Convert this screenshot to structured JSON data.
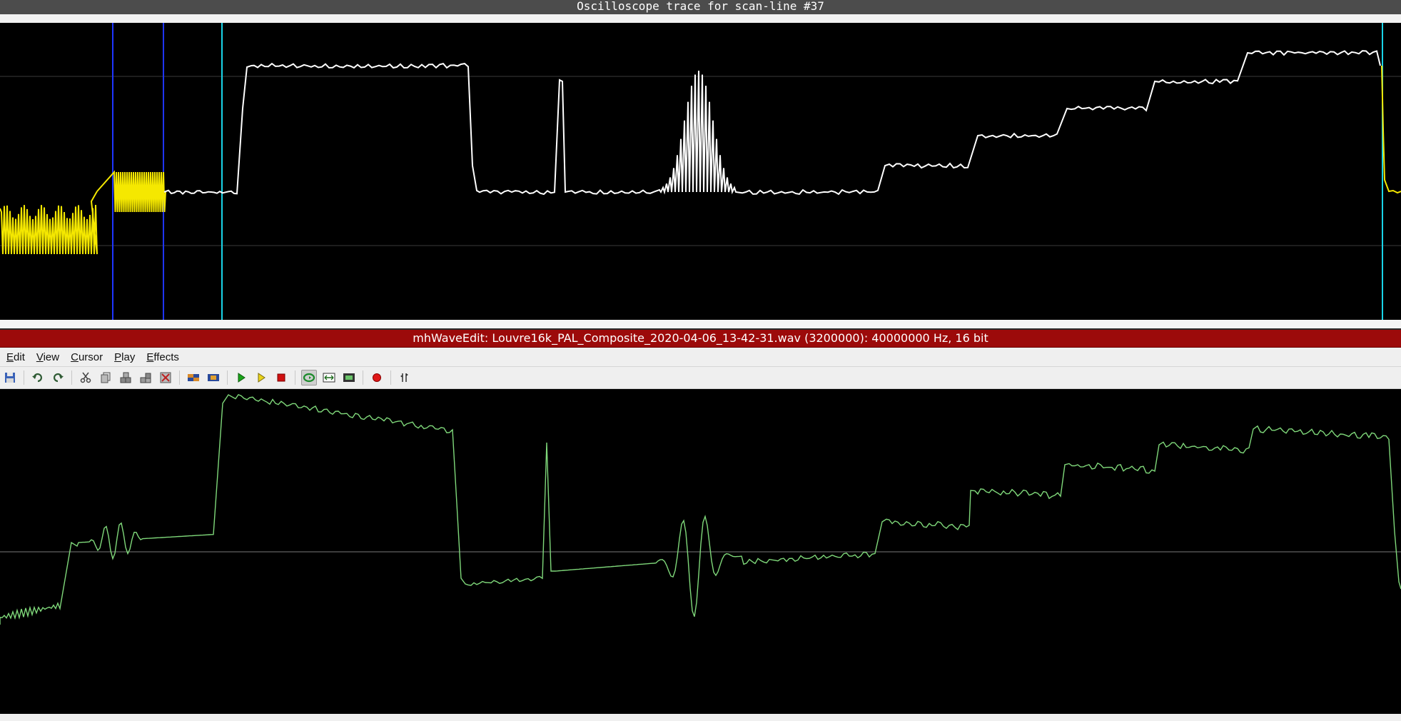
{
  "scope": {
    "title": "Oscilloscope trace for scan-line #37"
  },
  "editor": {
    "title": "mhWaveEdit: Louvre16k_PAL_Composite_2020-04-06_13-42-31.wav (3200000): 40000000 Hz, 16 bit",
    "menu": [
      {
        "key": "E",
        "rest": "dit"
      },
      {
        "key": "V",
        "rest": "iew"
      },
      {
        "key": "C",
        "rest": "ursor"
      },
      {
        "key": "P",
        "rest": "lay"
      },
      {
        "key": "E",
        "rest": "ffects"
      }
    ],
    "toolbar": {
      "icons": [
        "save-icon",
        "undo-icon",
        "redo-icon",
        "cut-icon",
        "copy-icon",
        "paste-icon",
        "paste-over-icon",
        "delete-icon",
        "mix-icon",
        "crop-icon",
        "play-icon",
        "play-selection-icon",
        "stop-icon",
        "loop-icon",
        "zoom-fit-icon",
        "zoom-selection-icon",
        "record-icon",
        "marker-icon"
      ]
    }
  },
  "colors": {
    "scope_trace": "#ffffff",
    "burst_trace": "#f5e800",
    "marker_blue": "#1e35ff",
    "marker_cyan": "#19d4e8",
    "wave_trace": "#7fd87a",
    "title_red": "#9c0a0a"
  }
}
